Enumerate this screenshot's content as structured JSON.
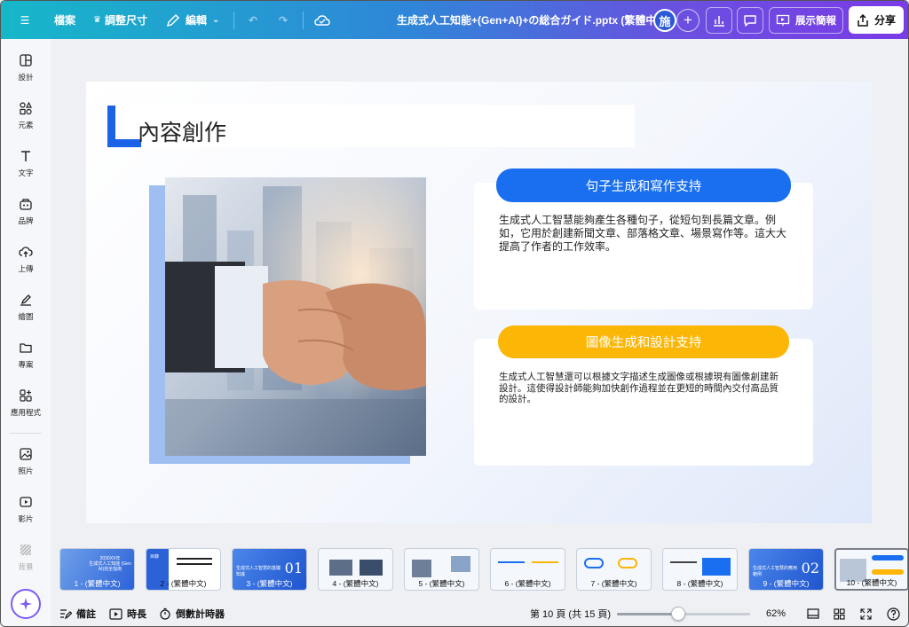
{
  "topbar": {
    "file_label": "檔案",
    "resize_label": "調整尺寸",
    "edit_label": "編輯",
    "doc_title": "生成式人工知能+(Gen+AI)+の総合ガイド.pptx (繁體中文)",
    "avatar_initial": "施",
    "present_label": "展示簡報",
    "share_label": "分享"
  },
  "sidebar": {
    "items": [
      {
        "label": "設計",
        "icon": "layout-icon"
      },
      {
        "label": "元素",
        "icon": "shapes-icon"
      },
      {
        "label": "文字",
        "icon": "text-icon"
      },
      {
        "label": "品牌",
        "icon": "brand-icon"
      },
      {
        "label": "上傳",
        "icon": "upload-icon"
      },
      {
        "label": "繪圖",
        "icon": "draw-icon"
      },
      {
        "label": "專案",
        "icon": "folder-icon"
      },
      {
        "label": "應用程式",
        "icon": "apps-icon"
      },
      {
        "label": "照片",
        "icon": "photo-icon"
      },
      {
        "label": "影片",
        "icon": "video-icon"
      },
      {
        "label": "背景",
        "icon": "background-icon"
      }
    ]
  },
  "slide": {
    "title": "內容創作",
    "card1": {
      "heading": "句子生成和寫作支持",
      "body": "生成式人工智慧能夠產生各種句子，從短句到長篇文章。例如，它用於創建新聞文章、部落格文章、場景寫作等。這大大提高了作者的工作效率。",
      "color": "#1a6ff0"
    },
    "card2": {
      "heading": "圖像生成和設計支持",
      "body": "生成式人工智慧還可以根據文字描述生成圖像或根據現有圖像創建新設計。這使得設計師能夠加快創作過程並在更短的時間內交付高品質的設計。",
      "color": "#fbb606"
    }
  },
  "filmstrip": {
    "thumbs": [
      {
        "label": "1 - (繁體中文)",
        "num": "",
        "cover_text": "2030XX年\n生成式人工知能 (Gen AI)完全指南"
      },
      {
        "label": "2 - (繁體中文)",
        "num": "",
        "cover_text": "目錄"
      },
      {
        "label": "3 - (繁體中文)",
        "num": "01",
        "cover_text": "生成式人工智慧的基礎知識"
      },
      {
        "label": "4 - (繁體中文)",
        "num": "",
        "cover_text": ""
      },
      {
        "label": "5 - (繁體中文)",
        "num": "",
        "cover_text": ""
      },
      {
        "label": "6 - (繁體中文)",
        "num": "",
        "cover_text": ""
      },
      {
        "label": "7 - (繁體中文)",
        "num": "",
        "cover_text": ""
      },
      {
        "label": "8 - (繁體中文)",
        "num": "",
        "cover_text": ""
      },
      {
        "label": "9 - (繁體中文)",
        "num": "02",
        "cover_text": "生成式人工智慧的應用範例"
      },
      {
        "label": "10 - (繁體中文)",
        "num": "",
        "cover_text": ""
      }
    ],
    "active_index": 9
  },
  "statusbar": {
    "notes_label": "備註",
    "duration_label": "時長",
    "timer_label": "倒數計時器",
    "page_info": "第 10 頁 (共 15 頁)",
    "zoom_label": "62%",
    "zoom_fraction": 0.46
  }
}
